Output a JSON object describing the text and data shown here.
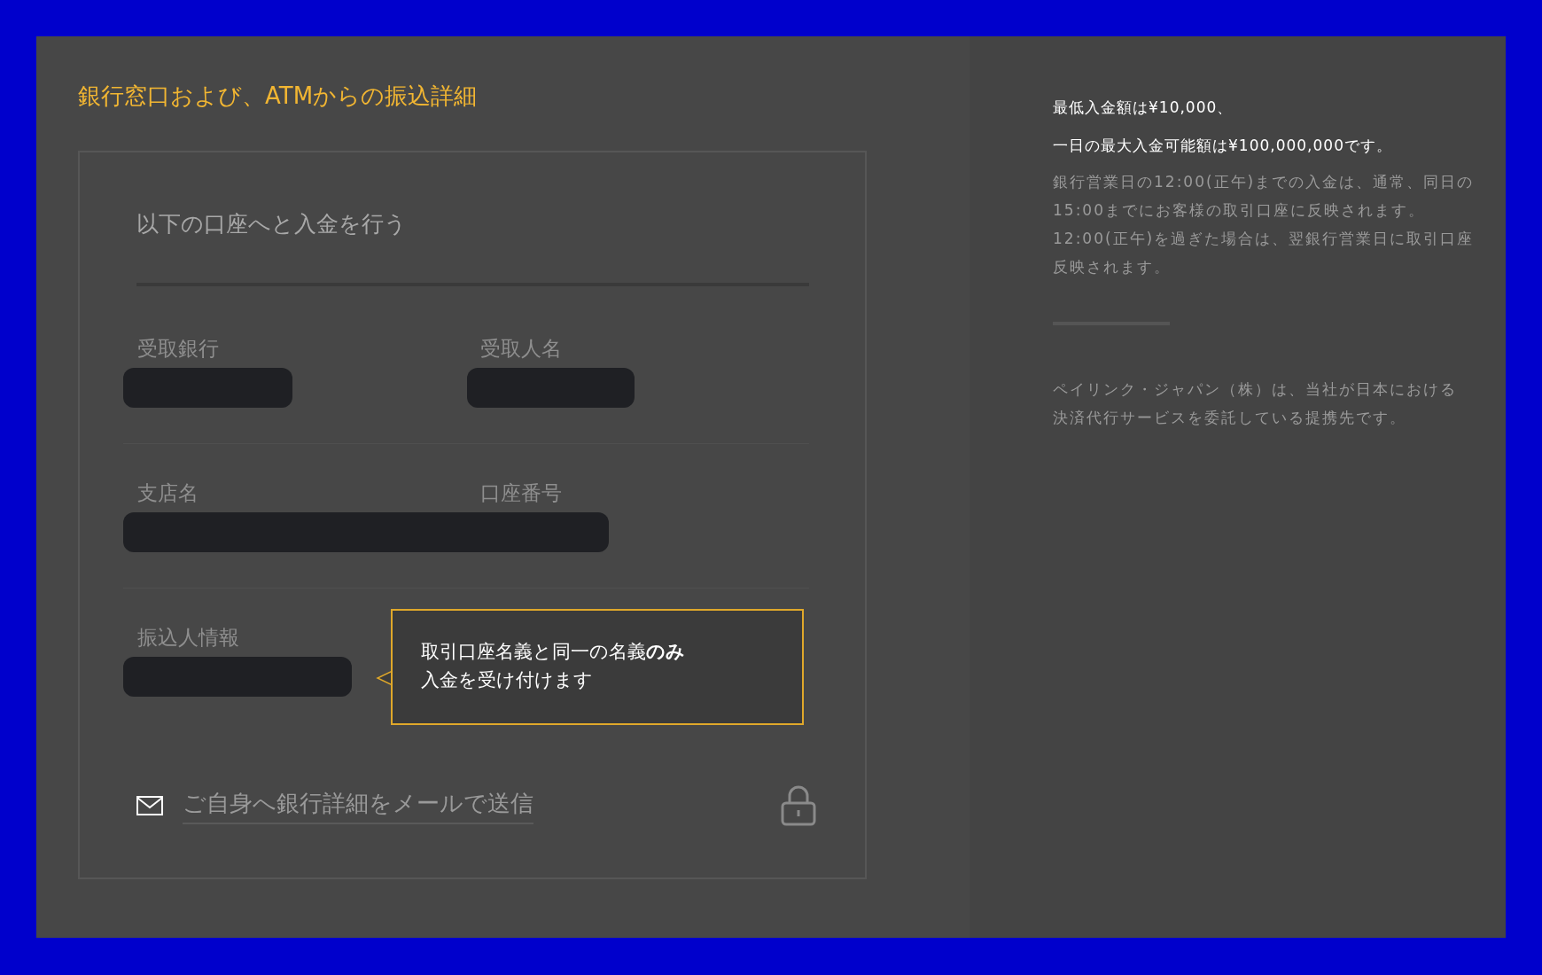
{
  "title": "銀行窓口および、ATMからの振込詳細",
  "card": {
    "heading": "以下の口座へと入金を行う",
    "rows": [
      {
        "labels": [
          "受取銀行",
          "受取人名"
        ]
      },
      {
        "labels": [
          "支店名",
          "口座番号"
        ]
      },
      {
        "labels": [
          "振込人情報"
        ]
      }
    ],
    "tooltip": [
      "取引口座名義と同一の名義**のみ**",
      "入金を受け付けます"
    ],
    "email_link": "ご自身へ銀行詳細をメールで送信"
  },
  "info": {
    "limits": [
      "最低入金額は¥10,000、",
      "一日の最大入金可能額は¥100,000,000です。"
    ],
    "notes": [
      "銀行営業日の12:00(正午)までの入金は、通常、同日の",
      "15:00までにお客様の取引口座に反映されます。",
      "12:00(正午)を過ぎた場合は、翌銀行営業日に取引口座",
      "反映されます。"
    ],
    "partner": [
      "ペイリンク・ジャパン（株）は、当社が日本における",
      "決済代行サービスを委託している提携先です。"
    ]
  }
}
